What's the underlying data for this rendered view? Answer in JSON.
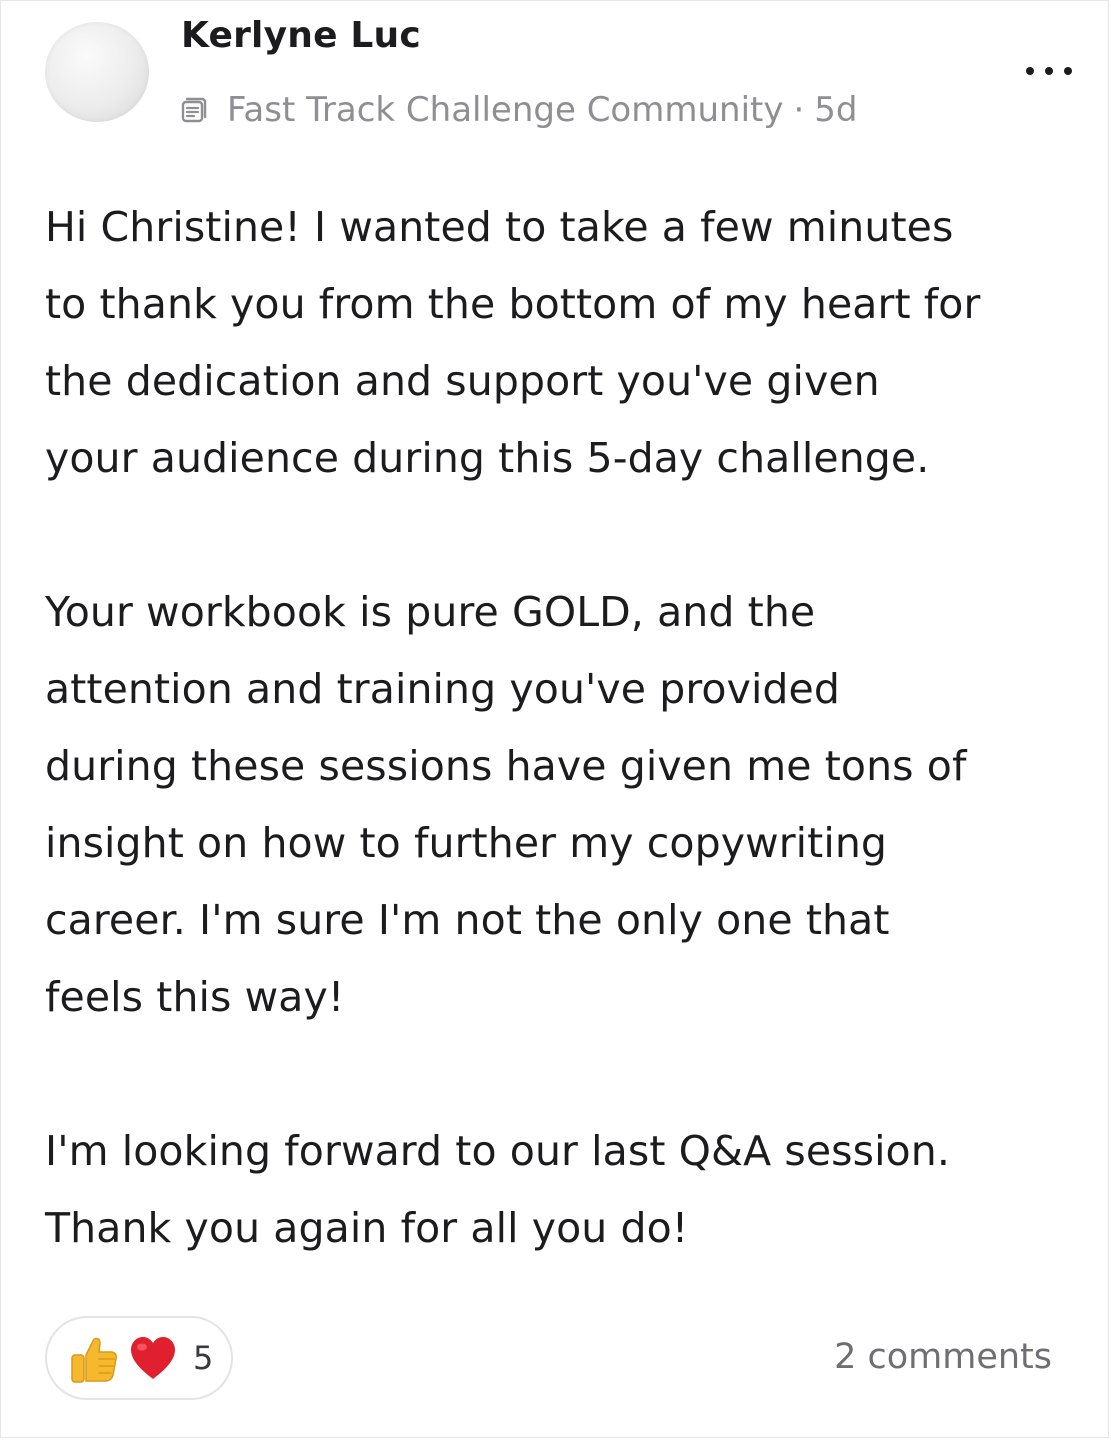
{
  "post": {
    "author_name": "Kerlyne Luc",
    "space_icon": "space-list-icon",
    "space_name": "Fast Track Challenge Community",
    "separator": "·",
    "age": "5d",
    "more_icon": "more-dots-icon",
    "paragraphs": [
      "Hi Christine! I wanted to take a few minutes\nto thank you from the bottom of my heart for\nthe dedication and support you've given\nyour audience during this 5-day challenge.",
      "Your workbook is pure GOLD, and the\nattention and training you've provided\nduring these sessions have given me tons of\ninsight on how to further my copywriting\ncareer. I'm sure I'm not the only one that\nfeels this way!",
      "I'm looking forward to our last Q&A session.\nThank you again for all you do!"
    ],
    "reactions": {
      "icons": [
        "thumbs-up-icon",
        "heart-icon"
      ],
      "count": "5"
    },
    "comments_label": "2 comments"
  },
  "colors": {
    "text": "#1c1c1e",
    "meta": "#8e8e93",
    "comments": "#6e6e73",
    "heart": "#e0202f",
    "thumb": "#f5b82e",
    "border": "#e6e6e8"
  }
}
